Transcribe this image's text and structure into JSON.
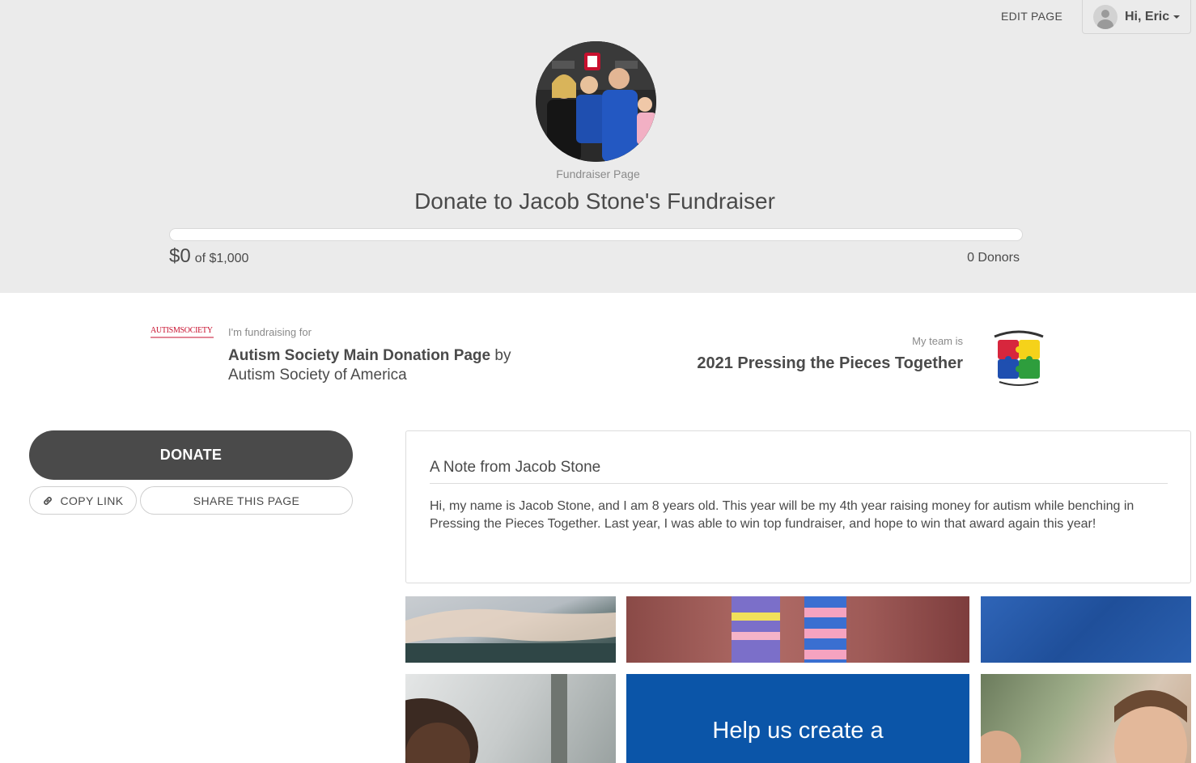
{
  "header": {
    "edit_page_label": "EDIT PAGE",
    "user_greeting": "Hi, Eric"
  },
  "hero": {
    "page_type_label": "Fundraiser Page",
    "title": "Donate to Jacob Stone's Fundraiser",
    "progress_fraction": 0,
    "raised_amount": "$0",
    "goal_text": "of $1,000",
    "donors_text": "0 Donors"
  },
  "fundraising_for": {
    "label": "I'm fundraising for",
    "campaign_name": "Autism Society Main Donation Page",
    "by_word": "by",
    "organization": "Autism Society of America",
    "logo_text": "AUTISMSOCIETY"
  },
  "team": {
    "label": "My team is",
    "name": "2021 Pressing the Pieces Together"
  },
  "actions": {
    "donate_label": "DONATE",
    "copy_link_label": "COPY LINK",
    "share_label": "SHARE THIS PAGE"
  },
  "note": {
    "title": "A Note from Jacob Stone",
    "body": "Hi, my name is Jacob Stone, and I am 8 years old. This year will be my 4th year raising money for autism while benching in Pressing the Pieces Together. Last year, I was able to win top fundraiser, and hope to win that award again this year!"
  },
  "gallery": {
    "banner_text": "Help us create a"
  },
  "colors": {
    "hero_background": "#ebebeb",
    "donate_button": "#4a4a4a",
    "banner_blue": "#0b55a8",
    "logo_red": "#c8102e"
  }
}
